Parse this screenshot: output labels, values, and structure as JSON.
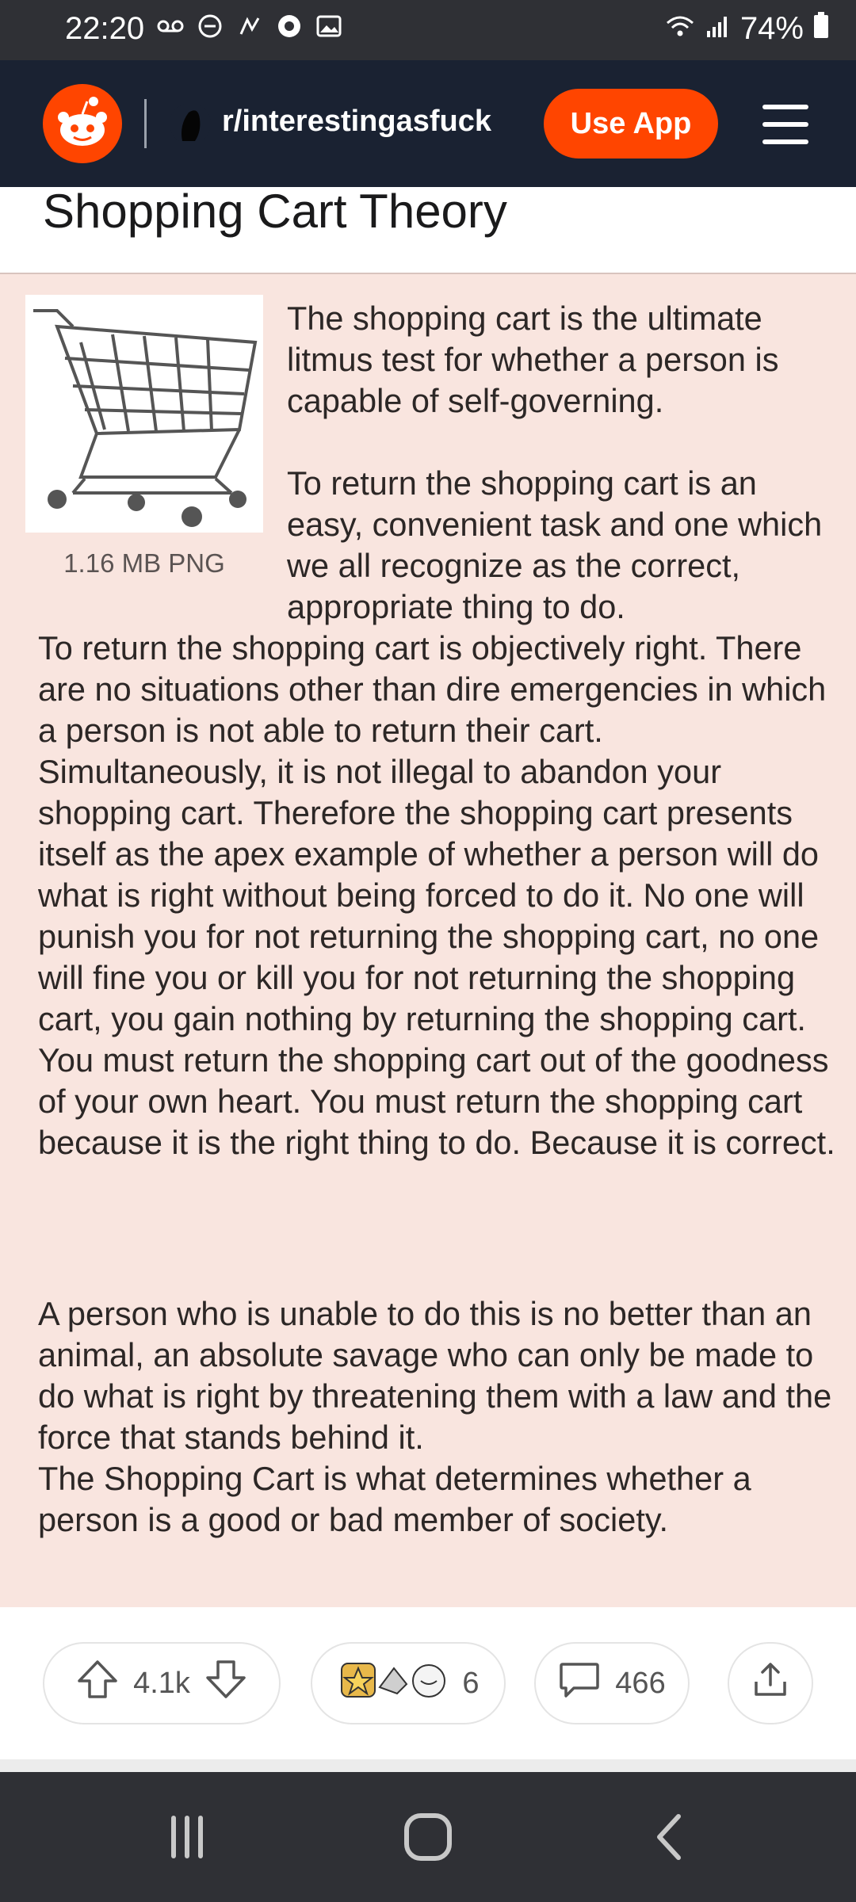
{
  "status_bar": {
    "time": "22:20",
    "battery": "74%",
    "icons": [
      "voicemail-icon",
      "do-not-disturb-icon",
      "signal-hand-icon",
      "app-notification-icon",
      "image-icon",
      "wifi-icon",
      "cellular-signal-icon",
      "battery-icon"
    ]
  },
  "header": {
    "subreddit": "r/interestingasfuck",
    "use_app_label": "Use App",
    "brand_color": "#ff4500"
  },
  "post": {
    "title": "Shopping Cart Theory",
    "image_caption": "1.16 MB PNG",
    "paragraph_1": "The shopping cart is the ultimate litmus test for whether a person is capable of self-governing.",
    "paragraph_2a": "To return the shopping cart is an easy, convenient task and one which we all recognize as the correct, appropriate thing to do.",
    "paragraph_2b": "To return the shopping cart is objectively right. There are no situations other than dire emergencies in which a person is not able to return their cart. Simultaneously, it is not illegal to abandon your shopping cart. Therefore the shopping cart presents itself as the apex example of whether a person will do what is right without being forced to do it. No one will punish you for not returning the shopping cart, no one will fine you or kill you for not returning the shopping cart, you gain nothing by returning the shopping cart. You must return the shopping cart out of the goodness of your own heart. You must return the shopping cart because it is the right thing to do. Because it is correct.",
    "paragraph_3": "A person who is unable to do this is no better than an animal, an absolute savage who can only be made to do what is right by threatening them with a law and the force that stands behind it.",
    "paragraph_4": "The Shopping Cart is what determines whether a person is a good or bad member of society."
  },
  "actions": {
    "votes": "4.1k",
    "awards_count": "6",
    "comments": "466"
  }
}
